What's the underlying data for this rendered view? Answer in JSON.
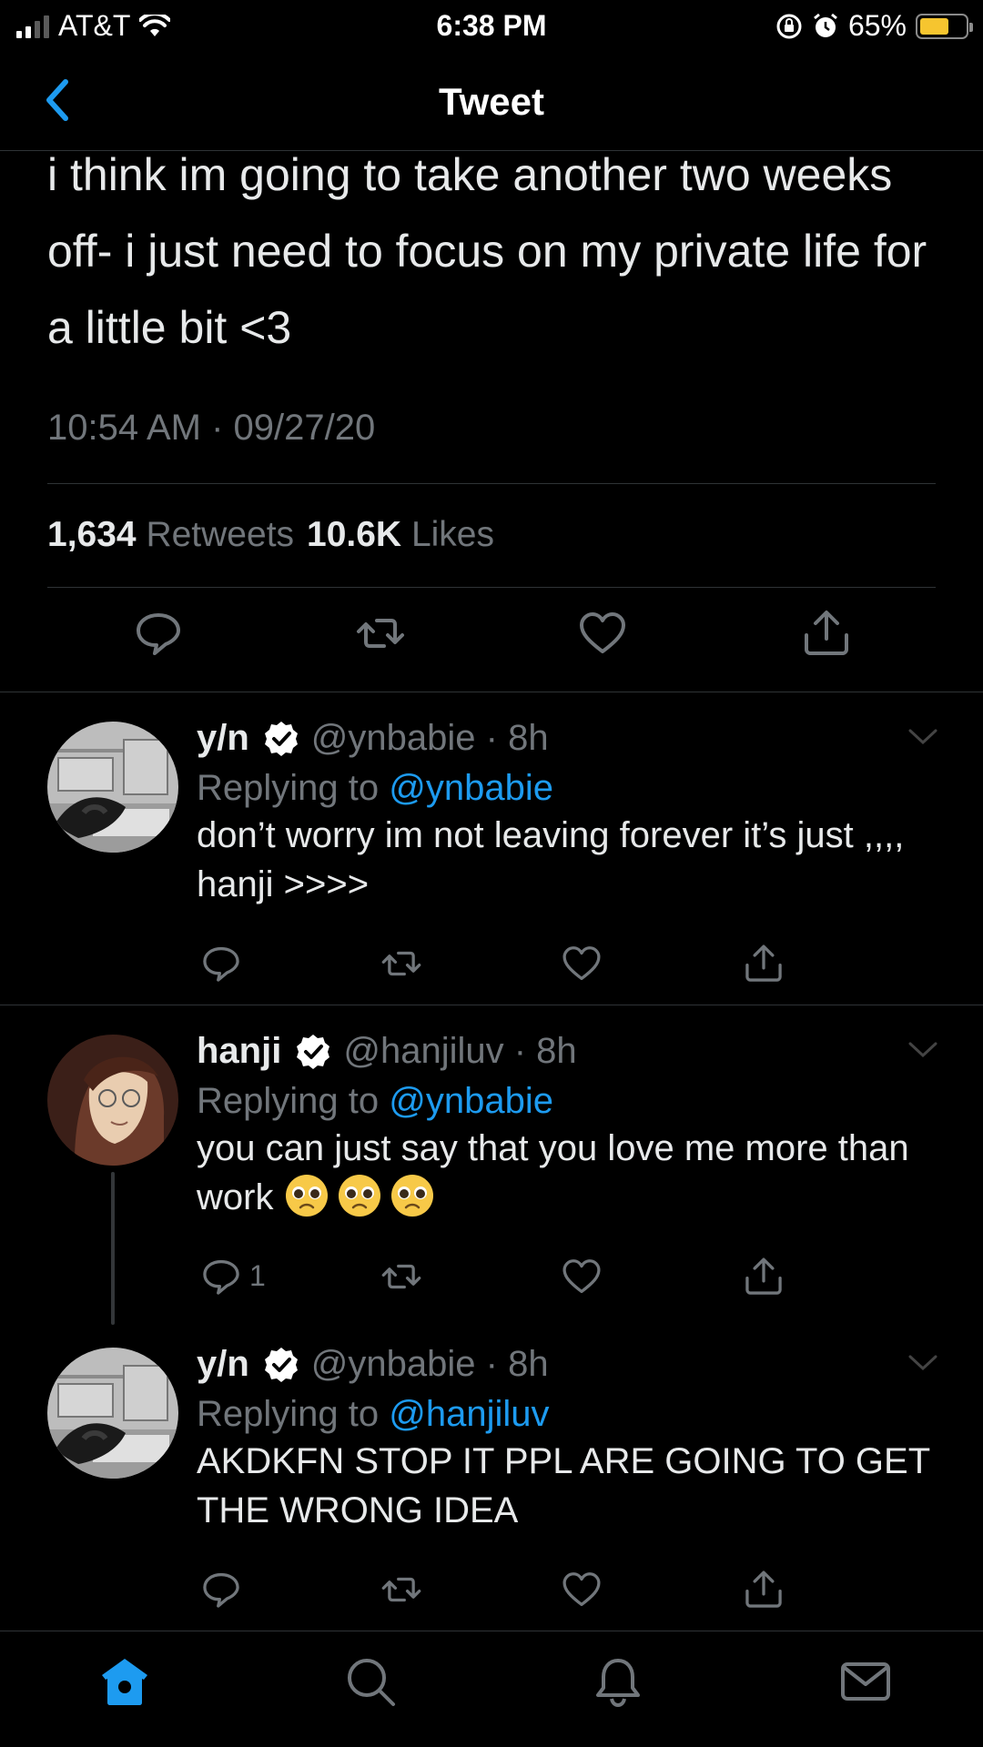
{
  "status_bar": {
    "carrier": "AT&T",
    "time": "6:38 PM",
    "battery_percent": "65%",
    "battery_level": 0.65
  },
  "nav": {
    "title": "Tweet"
  },
  "tweet": {
    "text": "i think im going to take another two weeks off- i just need to focus on my private life for a little bit <3",
    "timestamp": "10:54 AM · 09/27/20",
    "retweets_count": "1,634",
    "retweets_label": "Retweets",
    "likes_count": "10.6K",
    "likes_label": "Likes"
  },
  "replies": [
    {
      "name": "y/n",
      "handle": "@ynbabie · 8h",
      "replying_prefix": "Replying to ",
      "replying_to": "@ynbabie",
      "text": "don’t worry im not leaving forever it’s just ,,,, hanji >>>>",
      "reply_count": ""
    },
    {
      "name": "hanji",
      "handle": "@hanjiluv · 8h",
      "replying_prefix": "Replying to ",
      "replying_to": "@ynbabie",
      "text": "you can just say that you love me more than work",
      "reply_count": "1"
    },
    {
      "name": "y/n",
      "handle": "@ynbabie · 8h",
      "replying_prefix": "Replying to ",
      "replying_to": "@hanjiluv",
      "text": "AKDKFN STOP IT PPL ARE GOING TO GET THE WRONG IDEA",
      "reply_count": ""
    }
  ],
  "icons": {
    "back": "chevron-left-icon",
    "reply": "reply-icon",
    "retweet": "retweet-icon",
    "like": "heart-icon",
    "share": "share-icon",
    "home": "home-icon",
    "search": "search-icon",
    "notifications": "bell-icon",
    "messages": "mail-icon"
  },
  "colors": {
    "background": "#000000",
    "accent": "#1d9bf0",
    "secondary_text": "#71767b",
    "divider": "#2f3336",
    "battery": "#f6c52f"
  }
}
